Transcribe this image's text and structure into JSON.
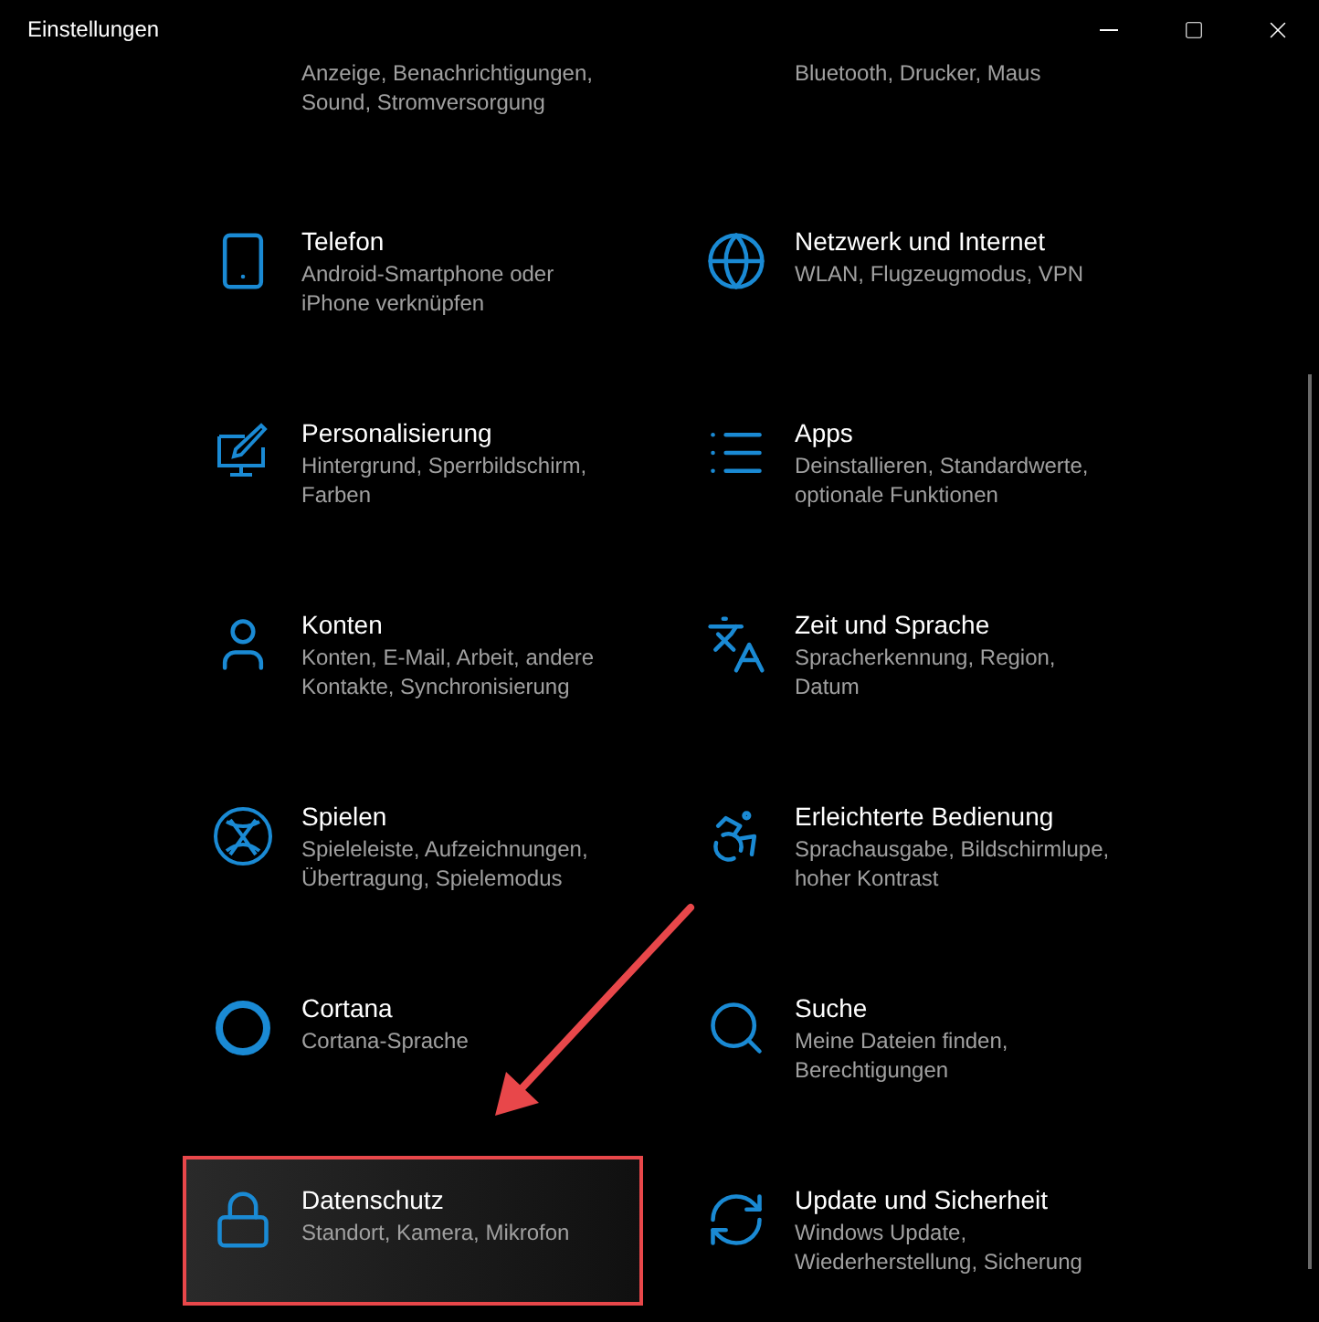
{
  "window": {
    "title": "Einstellungen"
  },
  "partial_row": [
    {
      "lines": [
        "Anzeige, Benachrichtigungen,",
        "Sound, Stromversorgung"
      ]
    },
    {
      "lines": [
        "Bluetooth, Drucker, Maus"
      ]
    }
  ],
  "categories": [
    {
      "title": "Telefon",
      "description": "Android-Smartphone oder iPhone verknüpfen",
      "highlighted": false
    },
    {
      "title": "Netzwerk und Internet",
      "description": "WLAN, Flugzeugmodus, VPN",
      "highlighted": false
    },
    {
      "title": "Personalisierung",
      "description": "Hintergrund, Sperrbildschirm, Farben",
      "highlighted": false
    },
    {
      "title": "Apps",
      "description": "Deinstallieren, Standardwerte, optionale Funktionen",
      "highlighted": false
    },
    {
      "title": "Konten",
      "description": "Konten, E-Mail, Arbeit, andere Kontakte, Synchronisierung",
      "highlighted": false
    },
    {
      "title": "Zeit und Sprache",
      "description": "Spracherkennung, Region, Datum",
      "highlighted": false
    },
    {
      "title": "Spielen",
      "description": "Spieleleiste, Aufzeichnungen, Übertragung, Spielemodus",
      "highlighted": false
    },
    {
      "title": "Erleichterte Bedienung",
      "description": "Sprachausgabe, Bildschirmlupe, hoher Kontrast",
      "highlighted": false
    },
    {
      "title": "Cortana",
      "description": "Cortana-Sprache",
      "highlighted": false
    },
    {
      "title": "Suche",
      "description": "Meine Dateien finden, Berechtigungen",
      "highlighted": false
    },
    {
      "title": "Datenschutz",
      "description": "Standort, Kamera, Mikrofon",
      "highlighted": true
    },
    {
      "title": "Update und Sicherheit",
      "description": "Windows Update, Wiederherstellung, Sicherung",
      "highlighted": false
    }
  ]
}
